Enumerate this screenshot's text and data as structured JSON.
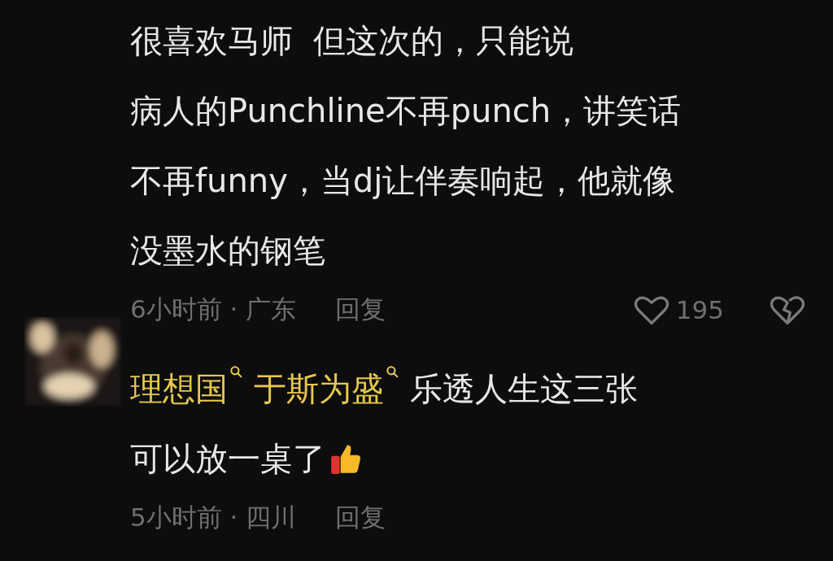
{
  "comments": [
    {
      "lines": [
        "很喜欢马师  但这次的，只能说",
        "病人的Punchline不再punch，讲笑话",
        "不再funny，当dj让伴奏响起，他就像",
        "没墨水的钢笔"
      ],
      "meta": "6小时前 · 广东",
      "reply": "回复",
      "likes": "195"
    },
    {
      "mentions": [
        "理想国",
        "于斯为盛"
      ],
      "lines": [
        "乐透人生这三张",
        "可以放一桌了"
      ],
      "emoji": true,
      "meta": "5小时前 · 四川",
      "reply": "回复",
      "avatar": true
    }
  ]
}
